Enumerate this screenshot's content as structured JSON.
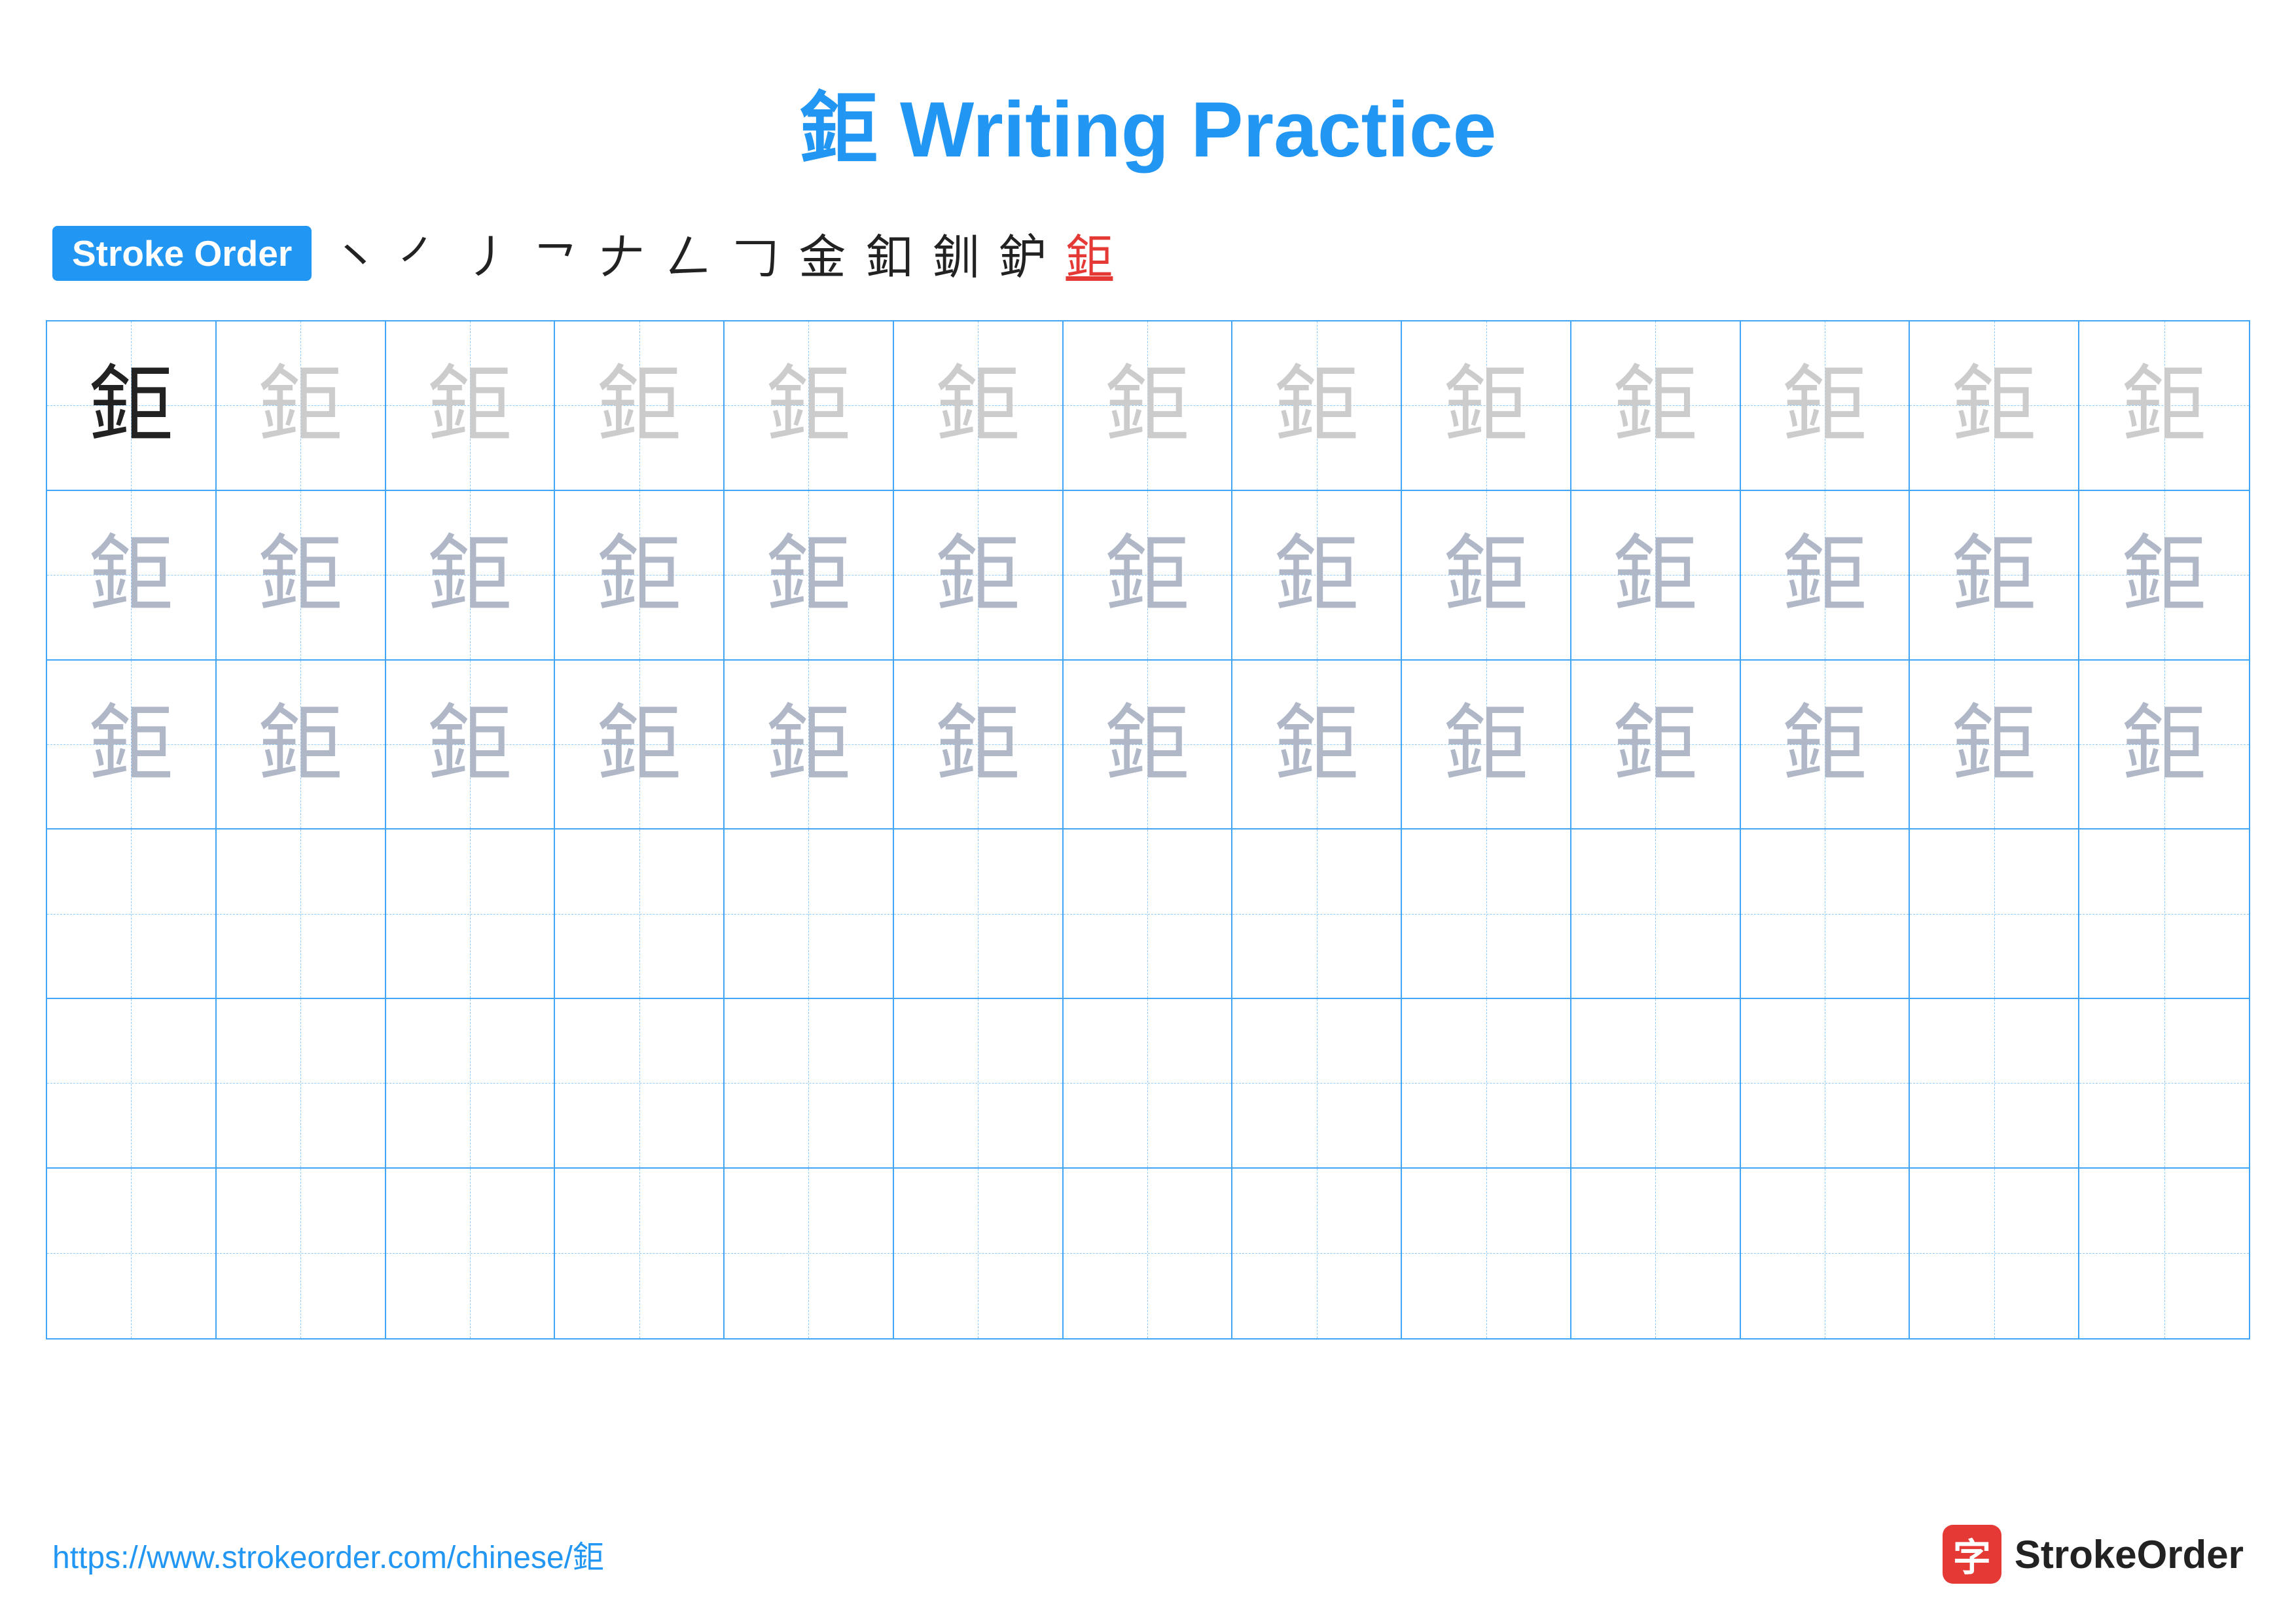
{
  "title": {
    "character": "鉅",
    "text": " Writing Practice"
  },
  "stroke_order": {
    "badge_label": "Stroke Order",
    "steps": [
      "㇔",
      "㇒",
      "㇓",
      "㇖",
      "𠂇",
      "𠃋",
      "𠃌",
      "金",
      "𨙾",
      "鈩",
      "鈩̄",
      "鉅"
    ],
    "highlight_index": 11
  },
  "grid": {
    "cols": 13,
    "rows": 6,
    "character": "鉅",
    "row1_type": "dark_then_light",
    "row2_type": "medium",
    "row3_type": "medium",
    "row4_type": "empty",
    "row5_type": "empty",
    "row6_type": "empty"
  },
  "footer": {
    "url": "https://www.strokeorder.com/chinese/鉅",
    "logo_icon": "字",
    "logo_text": "StrokeOrder"
  }
}
